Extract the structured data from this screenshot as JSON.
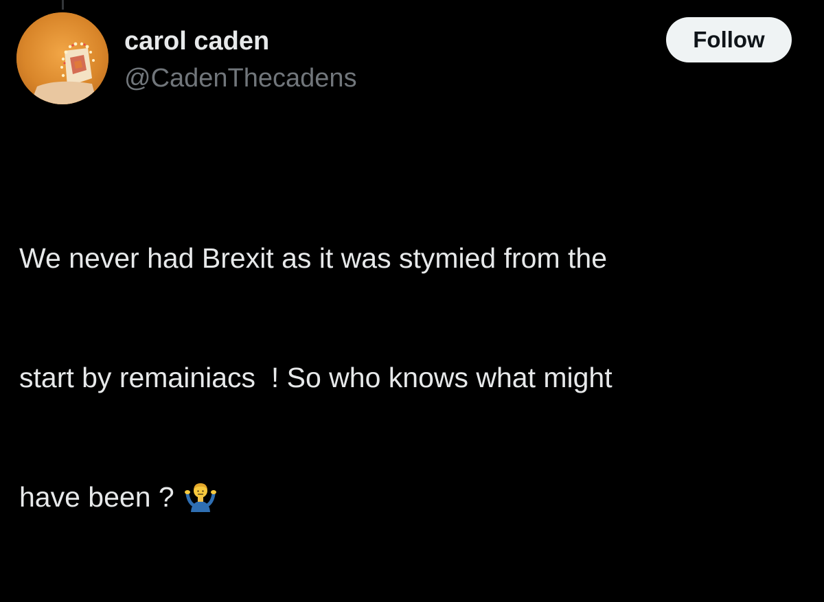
{
  "author": {
    "display_name": "carol caden",
    "handle": "@CadenThecadens"
  },
  "actions": {
    "follow_label": "Follow"
  },
  "tweet": {
    "lines": [
      "We never had Brexit as it was stymied from the",
      "start by remainiacs  ! So who knows what might",
      "have been ? "
    ],
    "emoji": "person-shrugging-emoji"
  },
  "colors": {
    "background": "#000000",
    "text_primary": "#e7e9ea",
    "text_secondary": "#71767b",
    "button_bg": "#eff3f4",
    "button_text": "#0f1419"
  }
}
